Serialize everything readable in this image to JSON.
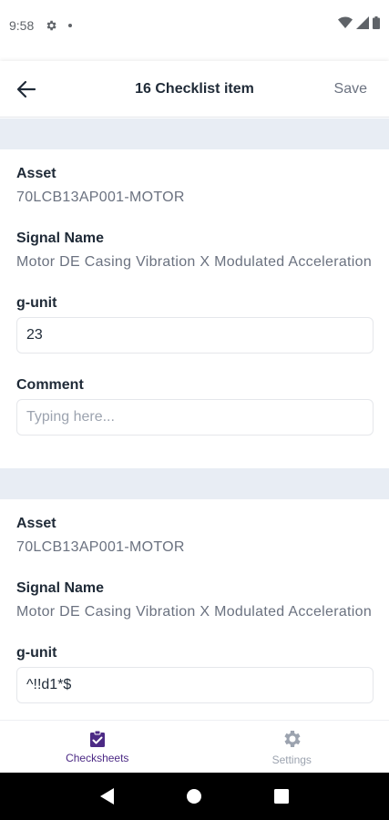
{
  "status_bar": {
    "time": "9:58",
    "icons": [
      "gear-icon",
      "dot-icon",
      "wifi-icon",
      "signal-icon",
      "battery-icon"
    ]
  },
  "header": {
    "title": "16 Checklist item",
    "save_label": "Save",
    "back_icon": "arrow-left-icon"
  },
  "items": [
    {
      "asset_label": "Asset",
      "asset_value": "70LCB13AP001-MOTOR",
      "signal_label": "Signal Name",
      "signal_value": "Motor DE Casing Vibration X Modulated Acceleration",
      "unit_label": "g-unit",
      "unit_value": "23",
      "comment_label": "Comment",
      "comment_placeholder": "Typing here..."
    },
    {
      "asset_label": "Asset",
      "asset_value": "70LCB13AP001-MOTOR",
      "signal_label": "Signal Name",
      "signal_value": "Motor DE Casing Vibration X Modulated Acceleration",
      "unit_label": "g-unit",
      "unit_value": "^!!d1*$"
    }
  ],
  "bottom_nav": {
    "items": [
      {
        "label": "Checksheets",
        "icon": "checklist-icon",
        "active": true
      },
      {
        "label": "Settings",
        "icon": "gear-icon",
        "active": false
      }
    ]
  },
  "colors": {
    "accent": "#4c2a85",
    "separator": "#e8edf4",
    "muted_text": "#6b7280"
  }
}
